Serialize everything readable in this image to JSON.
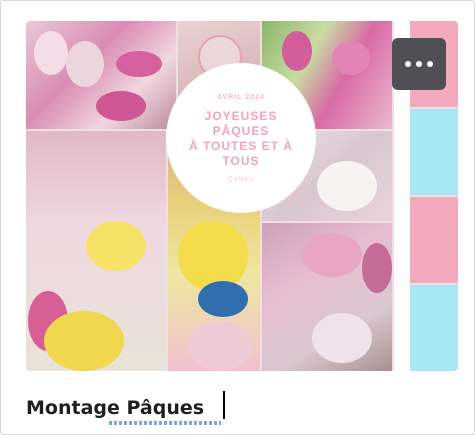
{
  "card": {
    "title": "Montage Pâques",
    "thumbnail": {
      "small_top_text": "AVRIL 2024",
      "headline": "JOYEUSES\nPÂQUES\nÀ TOUTES ET À\nTOUS",
      "small_bottom_text": "CANVA"
    },
    "more_button_icon": "more-horizontal-icon"
  },
  "colors": {
    "pink": "#f4a9bf",
    "cyan": "#a6e8f4",
    "button_bg": "#4f4f55",
    "text_pink": "#f4a3b9"
  }
}
